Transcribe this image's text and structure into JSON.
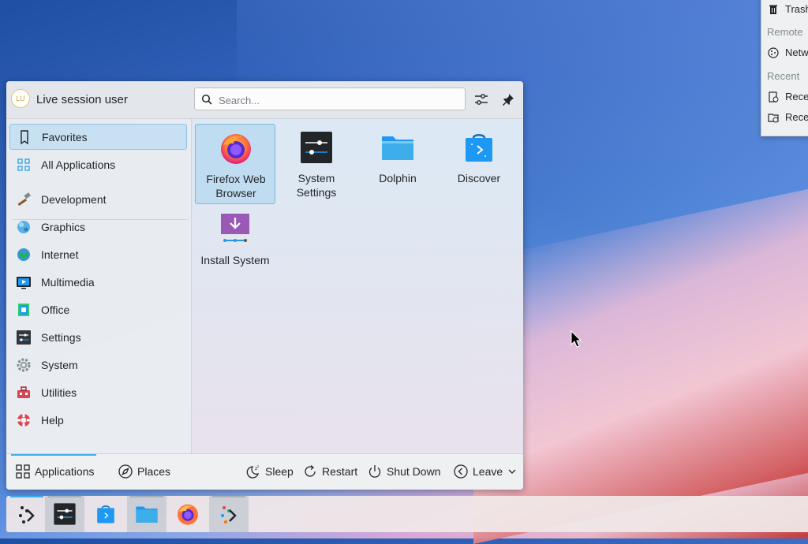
{
  "places_popup": {
    "items": [
      {
        "label": "Trash",
        "icon": "trash-icon",
        "kind": "item"
      },
      {
        "label": "Remote",
        "kind": "section"
      },
      {
        "label": "Network",
        "icon": "network-icon",
        "kind": "item"
      },
      {
        "label": "Recent",
        "kind": "section"
      },
      {
        "label": "Recent Files",
        "icon": "recent-files-icon",
        "kind": "item"
      },
      {
        "label": "Recent Locations",
        "icon": "recent-locations-icon",
        "kind": "item"
      }
    ]
  },
  "launcher": {
    "user": {
      "initials": "LU",
      "name": "Live session user"
    },
    "search": {
      "placeholder": "Search...",
      "value": ""
    },
    "header_buttons": [
      {
        "name": "configure-icon"
      },
      {
        "name": "pin-icon"
      }
    ],
    "sidebar": {
      "items": [
        {
          "label": "Favorites",
          "icon": "bookmark-icon",
          "selected": true
        },
        {
          "label": "All Applications",
          "icon": "grid-icon",
          "selected": false
        },
        {
          "label": "Development",
          "icon": "hammer-icon",
          "selected": false
        },
        {
          "label": "Graphics",
          "icon": "graphics-icon",
          "selected": false
        },
        {
          "label": "Internet",
          "icon": "globe-icon",
          "selected": false
        },
        {
          "label": "Multimedia",
          "icon": "multimedia-icon",
          "selected": false
        },
        {
          "label": "Office",
          "icon": "office-icon",
          "selected": false
        },
        {
          "label": "Settings",
          "icon": "settings-icon",
          "selected": false
        },
        {
          "label": "System",
          "icon": "gear-icon",
          "selected": false
        },
        {
          "label": "Utilities",
          "icon": "toolbox-icon",
          "selected": false
        },
        {
          "label": "Help",
          "icon": "lifebuoy-icon",
          "selected": false
        }
      ]
    },
    "favorites": [
      {
        "line1": "Firefox Web",
        "line2": "Browser",
        "icon": "firefox-icon",
        "selected": true
      },
      {
        "line1": "System",
        "line2": "Settings",
        "icon": "system-settings-icon",
        "selected": false
      },
      {
        "line1": "Dolphin",
        "line2": "",
        "icon": "dolphin-folder-icon",
        "selected": false
      },
      {
        "line1": "Discover",
        "line2": "",
        "icon": "discover-bag-icon",
        "selected": false
      },
      {
        "line1": "Install System",
        "line2": "",
        "icon": "install-system-icon",
        "selected": false
      }
    ],
    "footer": {
      "tabs": [
        {
          "label": "Applications",
          "icon": "applications-grid-icon",
          "active": true
        },
        {
          "label": "Places",
          "icon": "compass-icon",
          "active": false
        }
      ],
      "actions": [
        {
          "label": "Sleep",
          "icon": "sleep-icon"
        },
        {
          "label": "Restart",
          "icon": "restart-icon"
        },
        {
          "label": "Shut Down",
          "icon": "power-icon"
        },
        {
          "label": "Leave",
          "icon": "leave-icon"
        }
      ]
    }
  },
  "taskbar": {
    "tasks": [
      {
        "name": "kde-launcher-icon",
        "open": false,
        "active": true
      },
      {
        "name": "system-settings-task-icon",
        "open": true,
        "active": false
      },
      {
        "name": "discover-task-icon",
        "open": false,
        "active": false
      },
      {
        "name": "dolphin-task-icon",
        "open": true,
        "active": false
      },
      {
        "name": "firefox-task-icon",
        "open": false,
        "active": false
      },
      {
        "name": "kde-task-icon",
        "open": true,
        "active": false
      }
    ]
  },
  "colors": {
    "accent": "#3daee9",
    "selection": "#c7e0f2"
  }
}
